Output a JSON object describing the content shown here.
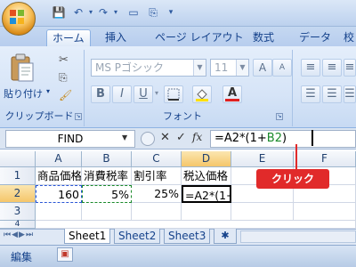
{
  "ribbon_tabs": [
    "ホーム",
    "挿入",
    "ページ レイアウト",
    "数式",
    "データ",
    "校"
  ],
  "clipboard": {
    "paste_label": "貼り付け",
    "group_label": "クリップボード"
  },
  "font": {
    "name": "MS Pゴシック",
    "size": "11",
    "group_label": "フォント",
    "bold": "B",
    "italic": "I",
    "underline": "U",
    "font_color_letter": "A"
  },
  "formula_bar": {
    "name_box": "FIND",
    "fx_label": "fx",
    "formula_prefix": "=A2*(1+",
    "formula_ref": "B2",
    "formula_suffix": ")",
    "cancel_symbol": "✕",
    "enter_symbol": "✓"
  },
  "grid": {
    "columns": [
      "A",
      "B",
      "C",
      "D",
      "E",
      "F"
    ],
    "rows": [
      "1",
      "2",
      "3",
      "4"
    ],
    "cells": {
      "A1": "商品価格",
      "B1": "消費税率",
      "C1": "割引率",
      "D1": "税込価格",
      "A2": "160",
      "B2": "5%",
      "C2": "25%",
      "D2": "=A2*(1+"
    }
  },
  "sheet_tabs": [
    "Sheet1",
    "Sheet2",
    "Sheet3"
  ],
  "status": {
    "mode": "編集"
  },
  "callout": {
    "label": "クリック"
  },
  "colors": {
    "accent": "#e12a2a",
    "ribbon": "#d6e4f7",
    "ref_blue": "#2a56d6",
    "ref_green": "#1a8a2a"
  }
}
